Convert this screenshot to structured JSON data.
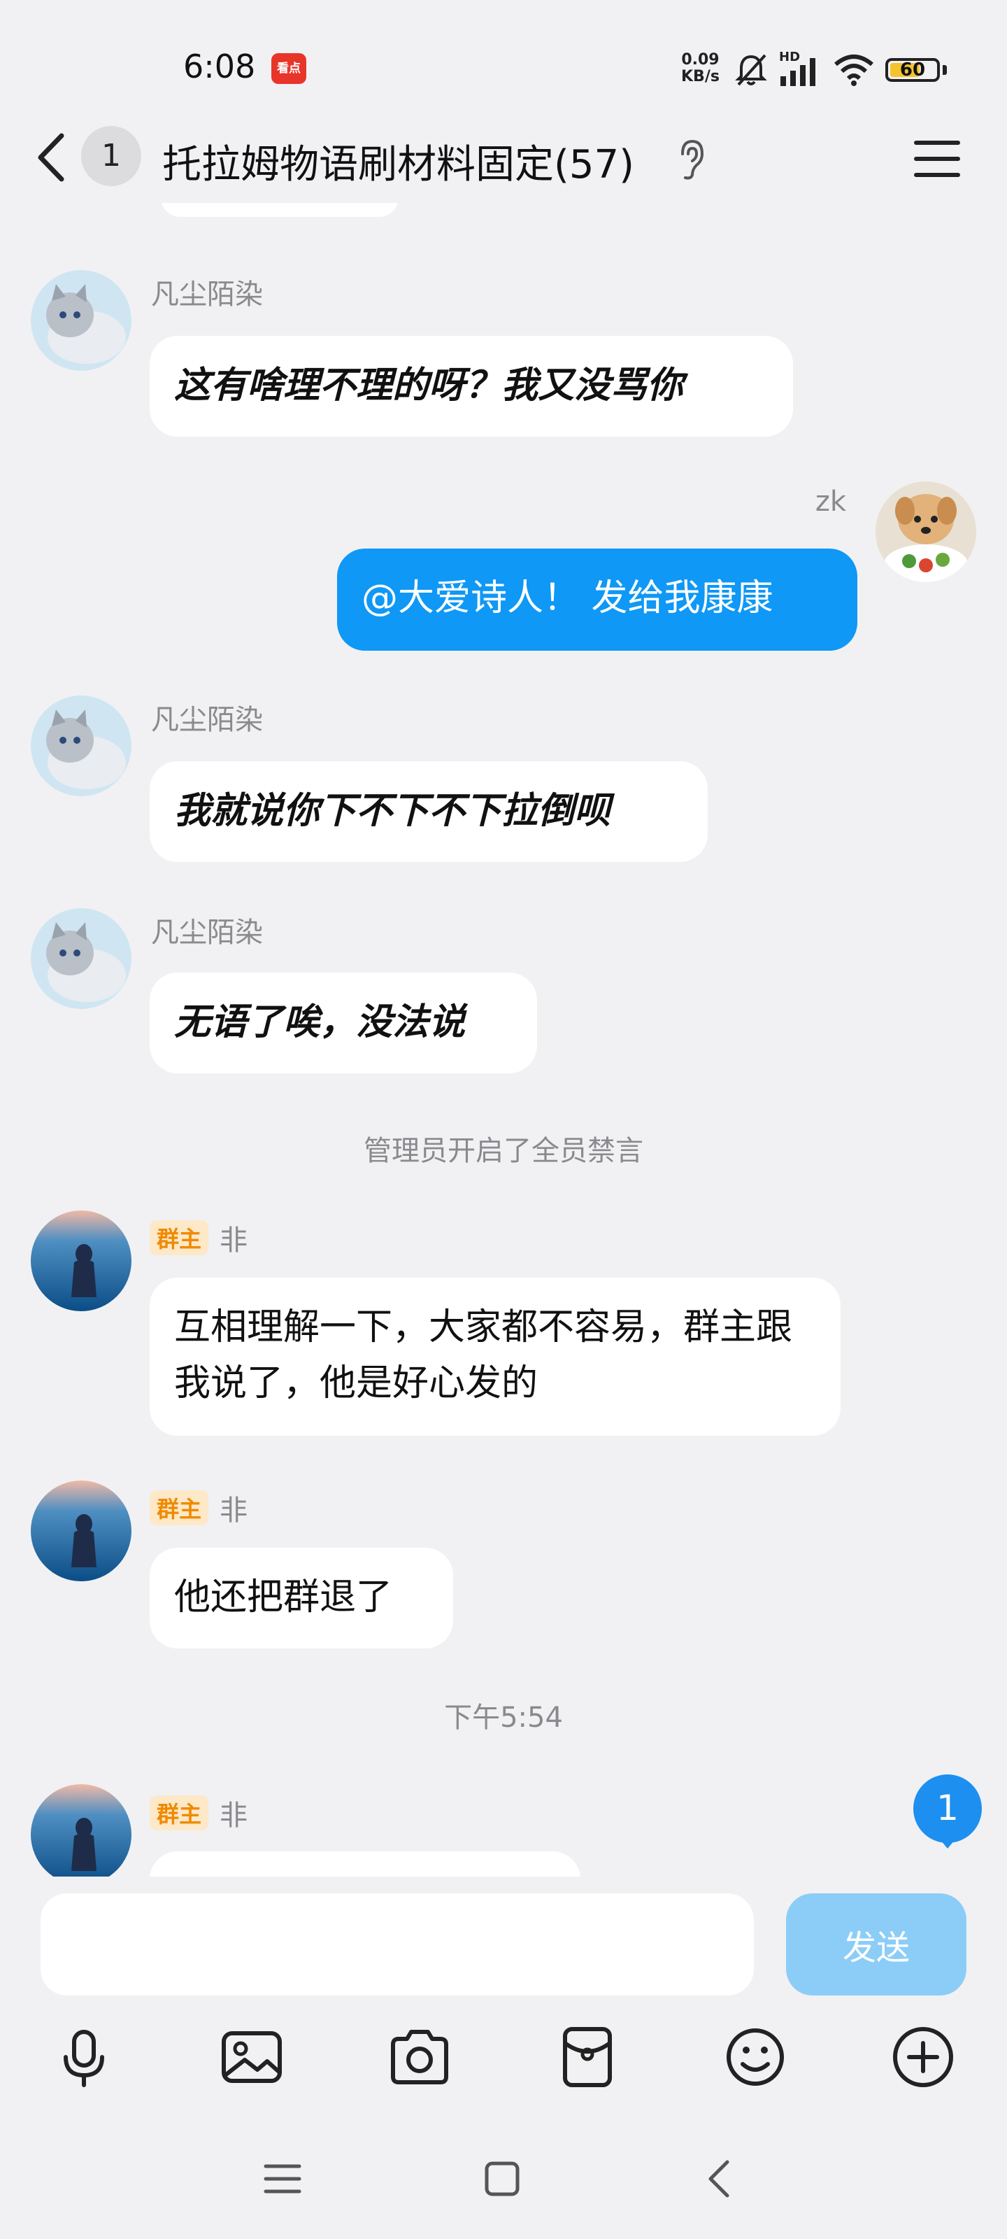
{
  "status_bar": {
    "time": "6:08",
    "app_badge": "看点",
    "net_speed_value": "0.09",
    "net_speed_unit": "KB/s",
    "signal_label": "HD",
    "battery": "60",
    "battery_level": 0.6
  },
  "header": {
    "unread_count": "1",
    "title": "托拉姆物语刷材料固定(57)"
  },
  "messages": [
    {
      "sender": "凡尘陌染",
      "text": "这有啥理不理的呀？我又没骂你",
      "avatar": "cat-avatar"
    },
    {
      "sender": "zk",
      "text": "@大爱诗人！ 发给我康康",
      "avatar": "dog-avatar",
      "mine": true
    },
    {
      "sender": "凡尘陌染",
      "text": "我就说你下不下不下拉倒呗",
      "avatar": "cat-avatar"
    },
    {
      "sender": "凡尘陌染",
      "text": "无语了唉，没法说",
      "avatar": "cat-avatar"
    },
    {
      "sender": "非",
      "badge": "群主",
      "text": "互相理解一下，大家都不容易，群主跟我说了，他是好心发的",
      "avatar": "girl-ocean-avatar"
    },
    {
      "sender": "非",
      "badge": "群主",
      "text": "他还把群退了",
      "avatar": "girl-ocean-avatar"
    },
    {
      "sender": "非",
      "badge": "群主",
      "text": "",
      "avatar": "girl-ocean-avatar"
    }
  ],
  "system_messages": {
    "mute_notice": "管理员开启了全员禁言",
    "timestamp": "下午5:54"
  },
  "new_message_badge": "1",
  "input": {
    "placeholder": "",
    "send_label": "发送"
  },
  "colors": {
    "my_bubble": "#0f98f5",
    "send_button": "#8ccdf8",
    "owner_badge_text": "#f08a00",
    "owner_badge_bg": "#fde8c8",
    "new_message_badge": "#1d8ff0"
  },
  "toolbar_icons": [
    "microphone-icon",
    "image-icon",
    "camera-icon",
    "red-packet-icon",
    "emoji-icon",
    "plus-icon"
  ],
  "nav_icons": [
    "menu-icon",
    "home-icon",
    "back-icon"
  ]
}
